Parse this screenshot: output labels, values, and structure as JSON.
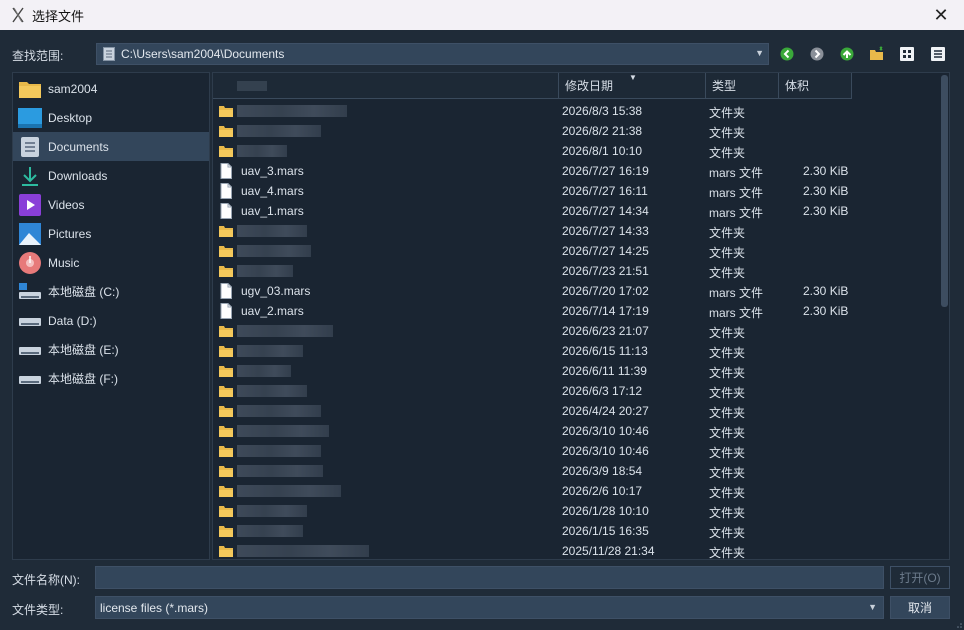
{
  "window": {
    "title": "选择文件",
    "close_glyph": "✕"
  },
  "lookin": {
    "label": "查找范围:",
    "path": "C:\\Users\\sam2004\\Documents"
  },
  "toolbar": {
    "buttons": [
      {
        "name": "back-button",
        "icon": "green-left-arrow-icon"
      },
      {
        "name": "forward-button",
        "icon": "gray-right-arrow-icon"
      },
      {
        "name": "parent-dir-button",
        "icon": "green-up-arrow-icon"
      },
      {
        "name": "new-folder-button",
        "icon": "new-folder-icon"
      },
      {
        "name": "list-view-button",
        "icon": "grid-icon"
      },
      {
        "name": "detail-view-button",
        "icon": "detail-list-icon"
      }
    ]
  },
  "sidebar": {
    "items": [
      {
        "label": "sam2004",
        "icon": "folder-icon"
      },
      {
        "label": "Desktop",
        "icon": "desktop-icon"
      },
      {
        "label": "Documents",
        "icon": "documents-icon",
        "selected": true
      },
      {
        "label": "Downloads",
        "icon": "download-icon"
      },
      {
        "label": "Videos",
        "icon": "videos-icon"
      },
      {
        "label": "Pictures",
        "icon": "pictures-icon"
      },
      {
        "label": "Music",
        "icon": "music-icon"
      },
      {
        "label": "本地磁盘 (C:)",
        "icon": "system-drive-icon"
      },
      {
        "label": "Data (D:)",
        "icon": "drive-icon"
      },
      {
        "label": "本地磁盘 (E:)",
        "icon": "drive-icon"
      },
      {
        "label": "本地磁盘 (F:)",
        "icon": "drive-icon"
      }
    ]
  },
  "columns": {
    "name": "",
    "date": "修改日期",
    "type": "类型",
    "size": "体积"
  },
  "files": [
    {
      "kind": "folder",
      "name": "",
      "date": "2026/8/3 15:38",
      "type": "文件夹",
      "size": ""
    },
    {
      "kind": "folder",
      "name": "",
      "date": "2026/8/2 21:38",
      "type": "文件夹",
      "size": ""
    },
    {
      "kind": "folder",
      "name": "",
      "date": "2026/8/1 10:10",
      "type": "文件夹",
      "size": ""
    },
    {
      "kind": "file",
      "name": "uav_3.mars",
      "date": "2026/7/27 16:19",
      "type": "mars 文件",
      "size": "2.30 KiB"
    },
    {
      "kind": "file",
      "name": "uav_4.mars",
      "date": "2026/7/27 16:11",
      "type": "mars 文件",
      "size": "2.30 KiB"
    },
    {
      "kind": "file",
      "name": "uav_1.mars",
      "date": "2026/7/27 14:34",
      "type": "mars 文件",
      "size": "2.30 KiB"
    },
    {
      "kind": "folder",
      "name": "",
      "date": "2026/7/27 14:33",
      "type": "文件夹",
      "size": ""
    },
    {
      "kind": "folder",
      "name": "",
      "date": "2026/7/27 14:25",
      "type": "文件夹",
      "size": ""
    },
    {
      "kind": "folder",
      "name": "",
      "date": "2026/7/23 21:51",
      "type": "文件夹",
      "size": ""
    },
    {
      "kind": "file",
      "name": "ugv_03.mars",
      "date": "2026/7/20 17:02",
      "type": "mars 文件",
      "size": "2.30 KiB"
    },
    {
      "kind": "file",
      "name": "uav_2.mars",
      "date": "2026/7/14 17:19",
      "type": "mars 文件",
      "size": "2.30 KiB"
    },
    {
      "kind": "folder",
      "name": "",
      "date": "2026/6/23 21:07",
      "type": "文件夹",
      "size": ""
    },
    {
      "kind": "folder",
      "name": "",
      "date": "2026/6/15 11:13",
      "type": "文件夹",
      "size": ""
    },
    {
      "kind": "folder",
      "name": "",
      "date": "2026/6/11 11:39",
      "type": "文件夹",
      "size": ""
    },
    {
      "kind": "folder",
      "name": "",
      "date": "2026/6/3 17:12",
      "type": "文件夹",
      "size": ""
    },
    {
      "kind": "folder",
      "name": "",
      "date": "2026/4/24 20:27",
      "type": "文件夹",
      "size": ""
    },
    {
      "kind": "folder",
      "name": "",
      "date": "2026/3/10 10:46",
      "type": "文件夹",
      "size": ""
    },
    {
      "kind": "folder",
      "name": "",
      "date": "2026/3/10 10:46",
      "type": "文件夹",
      "size": ""
    },
    {
      "kind": "folder",
      "name": "",
      "date": "2026/3/9 18:54",
      "type": "文件夹",
      "size": ""
    },
    {
      "kind": "folder",
      "name": "",
      "date": "2026/2/6 10:17",
      "type": "文件夹",
      "size": ""
    },
    {
      "kind": "folder",
      "name": "",
      "date": "2026/1/28 10:10",
      "type": "文件夹",
      "size": ""
    },
    {
      "kind": "folder",
      "name": "",
      "date": "2026/1/15 16:35",
      "type": "文件夹",
      "size": ""
    },
    {
      "kind": "folder",
      "name": "",
      "date": "2025/11/28 21:34",
      "type": "文件夹",
      "size": ""
    }
  ],
  "filename": {
    "label": "文件名称(N):",
    "value": "",
    "open_label": "打开(O)"
  },
  "filetype": {
    "label": "文件类型:",
    "value": "license files (*.mars)",
    "cancel_label": "取消"
  },
  "colors": {
    "background": "#1f2b38",
    "panel": "#1a2532",
    "field": "#33465b",
    "folder": "#e8b94a"
  }
}
